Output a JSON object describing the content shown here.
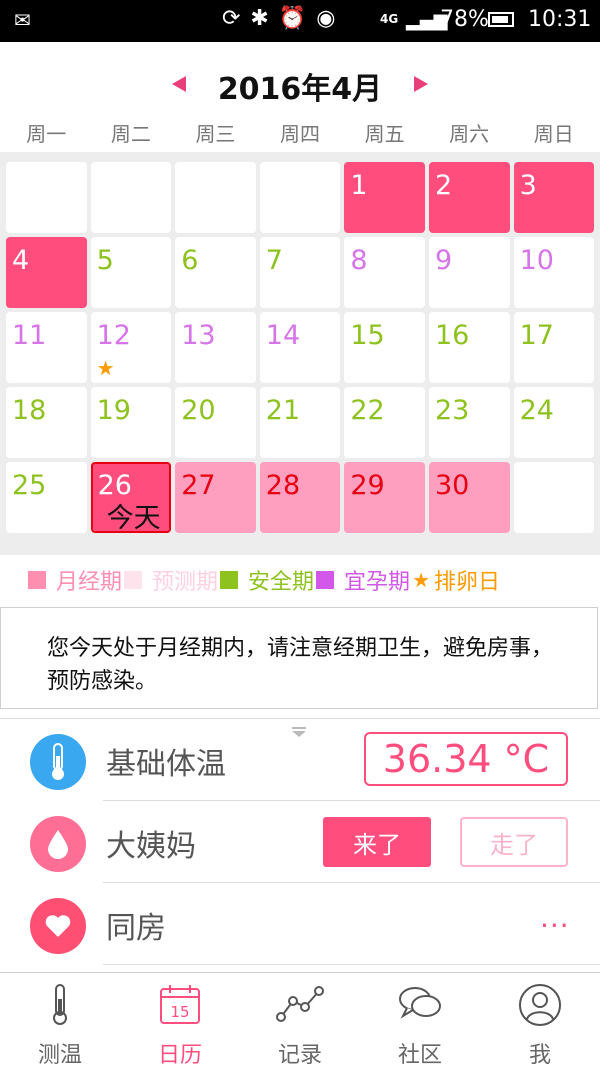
{
  "status_bar": {
    "network": "4G",
    "battery": "78%",
    "time": "10:31"
  },
  "header": {
    "month_title": "2016年4月",
    "weekdays": [
      "周一",
      "周二",
      "周三",
      "周四",
      "周五",
      "周六",
      "周日"
    ]
  },
  "calendar": {
    "cells": [
      {
        "day": "",
        "type": "empty"
      },
      {
        "day": "",
        "type": "empty"
      },
      {
        "day": "",
        "type": "empty"
      },
      {
        "day": "",
        "type": "empty"
      },
      {
        "day": "1",
        "type": "menses"
      },
      {
        "day": "2",
        "type": "menses"
      },
      {
        "day": "3",
        "type": "menses"
      },
      {
        "day": "4",
        "type": "menses"
      },
      {
        "day": "5",
        "type": "safe"
      },
      {
        "day": "6",
        "type": "safe"
      },
      {
        "day": "7",
        "type": "safe"
      },
      {
        "day": "8",
        "type": "fertile"
      },
      {
        "day": "9",
        "type": "fertile"
      },
      {
        "day": "10",
        "type": "fertile"
      },
      {
        "day": "11",
        "type": "fertile"
      },
      {
        "day": "12",
        "type": "fertile",
        "ovulation": true
      },
      {
        "day": "13",
        "type": "fertile"
      },
      {
        "day": "14",
        "type": "fertile"
      },
      {
        "day": "15",
        "type": "safe"
      },
      {
        "day": "16",
        "type": "safe"
      },
      {
        "day": "17",
        "type": "safe"
      },
      {
        "day": "18",
        "type": "safe"
      },
      {
        "day": "19",
        "type": "safe"
      },
      {
        "day": "20",
        "type": "safe"
      },
      {
        "day": "21",
        "type": "safe"
      },
      {
        "day": "22",
        "type": "safe"
      },
      {
        "day": "23",
        "type": "safe"
      },
      {
        "day": "24",
        "type": "safe"
      },
      {
        "day": "25",
        "type": "safe"
      },
      {
        "day": "26",
        "type": "today"
      },
      {
        "day": "27",
        "type": "predict"
      },
      {
        "day": "28",
        "type": "predict"
      },
      {
        "day": "29",
        "type": "predict"
      },
      {
        "day": "30",
        "type": "predict"
      },
      {
        "day": "",
        "type": "empty"
      }
    ],
    "today_label": "今天"
  },
  "legend": [
    {
      "label": "月经期",
      "color": "#ff8fb1",
      "text_color": "#ff8fb1"
    },
    {
      "label": "预测期",
      "color": "#ffe3ec",
      "text_color": "#ffd0de"
    },
    {
      "label": "安全期",
      "color": "#8dc21f",
      "text_color": "#8dc21f"
    },
    {
      "label": "宜孕期",
      "color": "#d158e8",
      "text_color": "#d158e8"
    },
    {
      "label": "排卵日",
      "color": "#ff9a00",
      "text_color": "#ff9a00",
      "icon": "star-icon"
    }
  ],
  "tip": {
    "text": "您今天处于月经期内，请注意经期卫生，避免房事，预防感染。"
  },
  "records": {
    "temperature": {
      "label": "基础体温",
      "value": "36.34 °C",
      "icon": "thermometer-icon",
      "color": "#3aa8f0"
    },
    "period": {
      "label": "大姨妈",
      "come_label": "来了",
      "go_label": "走了",
      "icon": "drop-icon",
      "color": "#ff6f95"
    },
    "intimacy": {
      "label": "同房",
      "more": "...",
      "icon": "heart-icon",
      "color": "#ff5074"
    }
  },
  "nav": {
    "tabs": [
      {
        "label": "测温",
        "icon": "thermometer-icon",
        "active": false
      },
      {
        "label": "日历",
        "icon": "calendar-icon",
        "active": true
      },
      {
        "label": "记录",
        "icon": "chart-line-icon",
        "active": false
      },
      {
        "label": "社区",
        "icon": "chat-bubbles-icon",
        "active": false
      },
      {
        "label": "我",
        "icon": "user-icon",
        "active": false
      }
    ],
    "calendar_icon_day": "15"
  },
  "colors": {
    "accent": "#ff4d7e",
    "safe": "#8dc21f",
    "fertile": "#d675e8",
    "predict_bg": "#ff9fbf",
    "ovulation": "#ff9a00"
  }
}
